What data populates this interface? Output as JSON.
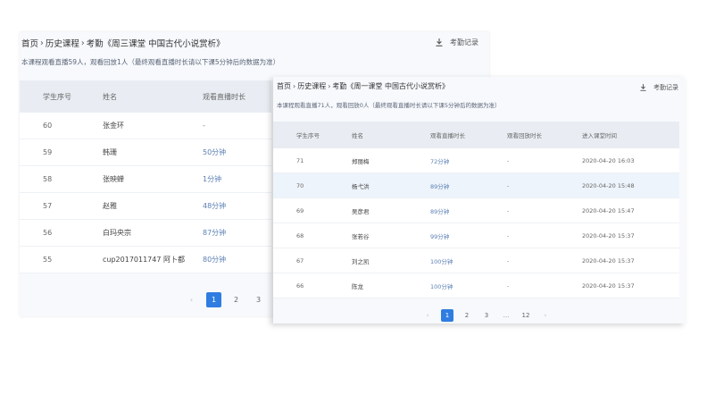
{
  "back_panel": {
    "breadcrumb": [
      "首页",
      "历史课程",
      "考勤《周三课堂 中国古代小说赏析》"
    ],
    "separator": "›",
    "record_label": "考勤记录",
    "note": "本课程观看直播59人，观看回放1人（最终观看直播时长请以下课5分钟后的数据为准）",
    "columns": [
      "学生序号",
      "姓名",
      "观看直播时长"
    ],
    "rows": [
      {
        "seq": "60",
        "name": "张金环",
        "duration": "-"
      },
      {
        "seq": "59",
        "name": "韩珊",
        "duration": "50分钟"
      },
      {
        "seq": "58",
        "name": "张映蝉",
        "duration": "1分钟"
      },
      {
        "seq": "57",
        "name": "赵雅",
        "duration": "48分钟"
      },
      {
        "seq": "56",
        "name": "白玛央宗",
        "duration": "87分钟"
      },
      {
        "seq": "55",
        "name": "cup2017011747 阿卜都",
        "duration": "80分钟"
      }
    ],
    "pagination": {
      "prev": "‹",
      "pages": [
        "1",
        "2",
        "3"
      ],
      "active": "1"
    }
  },
  "front_panel": {
    "breadcrumb": [
      "首页",
      "历史课程",
      "考勤《周一课堂 中国古代小说赏析》"
    ],
    "separator": "›",
    "record_label": "考勤记录",
    "note": "本课程观看直播71人，观看回放0人（最终观看直播时长请以下课5分钟后的数据为准）",
    "columns": [
      "学生序号",
      "姓名",
      "观看直播时长",
      "观看回放时长",
      "进入课堂时间"
    ],
    "rows": [
      {
        "seq": "71",
        "name": "郑丽梅",
        "duration": "72分钟",
        "replay": "-",
        "time": "2020-04-20 16:03"
      },
      {
        "seq": "70",
        "name": "杨弋洪",
        "duration": "89分钟",
        "replay": "-",
        "time": "2020-04-20 15:48"
      },
      {
        "seq": "69",
        "name": "吴彦君",
        "duration": "89分钟",
        "replay": "-",
        "time": "2020-04-20 15:47"
      },
      {
        "seq": "68",
        "name": "张若谷",
        "duration": "99分钟",
        "replay": "-",
        "time": "2020-04-20 15:37"
      },
      {
        "seq": "67",
        "name": "刘之凯",
        "duration": "100分钟",
        "replay": "-",
        "time": "2020-04-20 15:37"
      },
      {
        "seq": "66",
        "name": "陈龙",
        "duration": "100分钟",
        "replay": "-",
        "time": "2020-04-20 15:37"
      }
    ],
    "pagination": {
      "prev": "‹",
      "pages": [
        "1",
        "2",
        "3"
      ],
      "ellipsis": "...",
      "last": "12",
      "next": "›",
      "active": "1"
    }
  },
  "colors": {
    "accent": "#2f7de1",
    "duration_text": "#5b7fb4",
    "header_bg": "#e9edf3",
    "panel_bg": "#f7f9fc"
  },
  "icons": {
    "record": "download-icon"
  }
}
